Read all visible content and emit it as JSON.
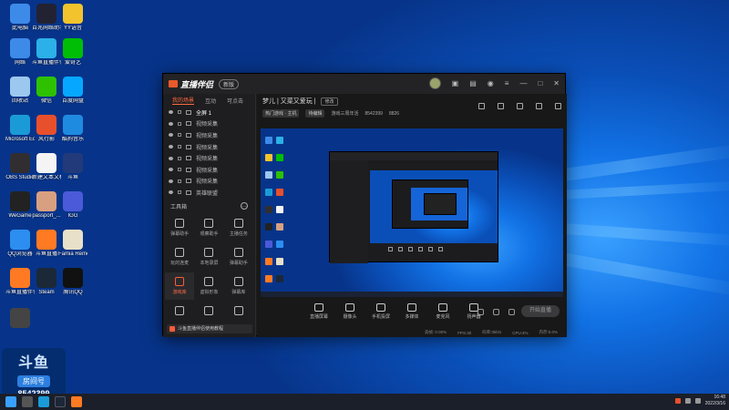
{
  "desktop": {
    "icons": [
      {
        "label": "此电脑",
        "icon": "computer-icon",
        "color": "#3d8ae8"
      },
      {
        "label": "百兆网络助手",
        "icon": "network-assistant-icon",
        "color": "#223"
      },
      {
        "label": "YY语音",
        "icon": "yy-icon",
        "color": "#f2c32c"
      },
      {
        "label": "网络",
        "icon": "network-icon",
        "color": "#3d8ae8"
      },
      {
        "label": "斗鱼直播伴侣",
        "icon": "douyu-app-icon",
        "color": "#2bb0e8"
      },
      {
        "label": "爱奇艺",
        "icon": "iqiyi-icon",
        "color": "#00be06"
      },
      {
        "label": "回收站",
        "icon": "recycle-bin-icon",
        "color": "#9cc7ee"
      },
      {
        "label": "微信",
        "icon": "wechat-icon",
        "color": "#2dc100"
      },
      {
        "label": "百度网盘",
        "icon": "baidu-netdisk-icon",
        "color": "#06a7ff"
      },
      {
        "label": "Microsoft Edge",
        "icon": "edge-icon",
        "color": "#1a9bd7"
      },
      {
        "label": "风行影",
        "icon": "video-player-icon",
        "color": "#e8502c"
      },
      {
        "label": "酷狗音乐",
        "icon": "kugou-icon",
        "color": "#1f8be0"
      },
      {
        "label": "OBS Studio",
        "icon": "obs-icon",
        "color": "#302e31"
      },
      {
        "label": "新建文本文档",
        "icon": "text-document-icon",
        "color": "#f4f4f4"
      },
      {
        "label": "斗鱼",
        "icon": "douyu-icon",
        "color": "#223a7a"
      },
      {
        "label": "WeGame",
        "icon": "wegame-icon",
        "color": "#222"
      },
      {
        "label": "passport_...",
        "icon": "photo-icon",
        "color": "#d8a080"
      },
      {
        "label": "IGG",
        "icon": "igg-icon",
        "color": "#4a5ad8"
      },
      {
        "label": "QQ浏览器",
        "icon": "qq-browser-icon",
        "color": "#2c8ef0"
      },
      {
        "label": "斗鱼直播",
        "icon": "douyu-live-icon",
        "color": "#ff7a22"
      },
      {
        "label": "Famia Remote ...",
        "icon": "remote-icon",
        "color": "#e8e0c8"
      },
      {
        "label": "斗鱼直播伴侣",
        "icon": "douyu-companion-icon",
        "color": "#ff7a22"
      },
      {
        "label": "Steam",
        "icon": "steam-icon",
        "color": "#1b2838"
      },
      {
        "label": "腾讯QQ",
        "icon": "qq-icon",
        "color": "#111"
      },
      {
        "label": "",
        "icon": "shortcut-icon",
        "color": "#444"
      }
    ],
    "watermark": {
      "logo": "斗鱼",
      "room": "房间号",
      "number": "8542399"
    }
  },
  "app": {
    "brand": "直播伴侣",
    "badge": "新版",
    "title_icons": [
      "avatar",
      "gift-icon",
      "bag-icon",
      "bell-icon",
      "menu-icon",
      "minimize-icon",
      "maximize-icon",
      "close-icon"
    ],
    "tabs": [
      {
        "label": "我的场景",
        "active": true
      },
      {
        "label": "互动",
        "active": false
      },
      {
        "label": "可点击",
        "active": false
      }
    ],
    "scenes": [
      {
        "label": "全屏 1",
        "active": true
      },
      {
        "label": "视频采集",
        "active": false
      },
      {
        "label": "视频采集",
        "active": false
      },
      {
        "label": "视频采集",
        "active": false
      },
      {
        "label": "视频采集",
        "active": false
      },
      {
        "label": "视频采集",
        "active": false
      },
      {
        "label": "视频采集",
        "active": false
      },
      {
        "label": "英雄联盟",
        "active": false
      }
    ],
    "tools_title": "工具箱",
    "tools": [
      {
        "label": "弹幕助手",
        "icon": "danmaku-icon",
        "active": false
      },
      {
        "label": "观察助手",
        "icon": "user-icon",
        "active": false
      },
      {
        "label": "主播任务",
        "icon": "task-icon",
        "active": false
      },
      {
        "label": "玩的连麦",
        "icon": "connect-icon",
        "active": false
      },
      {
        "label": "本地录屏",
        "icon": "download-icon",
        "active": false
      },
      {
        "label": "弹幕助手",
        "icon": "message-icon",
        "active": false
      },
      {
        "label": "游戏库",
        "icon": "game-icon",
        "active": true
      },
      {
        "label": "虚拟形象",
        "icon": "download-icon",
        "active": false
      },
      {
        "label": "弹幕库",
        "icon": "library-icon",
        "active": false
      },
      {
        "label": "",
        "icon": "grid-icon",
        "active": false
      },
      {
        "label": "",
        "icon": "record-icon",
        "active": false
      },
      {
        "label": "",
        "icon": "upload-icon",
        "active": false
      }
    ],
    "notice": "斗鱼直播伴侣使用教程",
    "room": {
      "title": "梦儿 | 又菜又爱玩 |",
      "edit": "修改",
      "category": "热门游戏 · 主机",
      "status_chip": "待编辑",
      "fans_label": "游戏三周年活",
      "room_id": "8542399",
      "heat": "8826"
    },
    "header_icons": [
      "gift-box-icon",
      "shop-icon",
      "folder-icon",
      "bell-icon",
      "share-icon"
    ],
    "controls": [
      {
        "label": "直播屏幕",
        "icon": "screen-icon"
      },
      {
        "label": "摄像头",
        "icon": "camera-icon"
      },
      {
        "label": "手机投屏",
        "icon": "phone-cast-icon"
      },
      {
        "label": "多媒体",
        "icon": "media-icon"
      },
      {
        "label": "麦克风",
        "icon": "microphone-icon"
      },
      {
        "label": "扬声器",
        "icon": "speaker-icon"
      }
    ],
    "go_live": "开始直播",
    "status_bar": [
      "丢帧: 0.00%",
      "FPS:30",
      "码率:0kb/s",
      "CPU:4%",
      "内存:0.0%"
    ]
  },
  "taskbar": {
    "apps": [
      "start-icon",
      "search-icon",
      "edge-taskbar-icon",
      "steam-taskbar-icon",
      "douyu-taskbar-icon"
    ],
    "time": "16:48",
    "date": "2022/3/16"
  }
}
